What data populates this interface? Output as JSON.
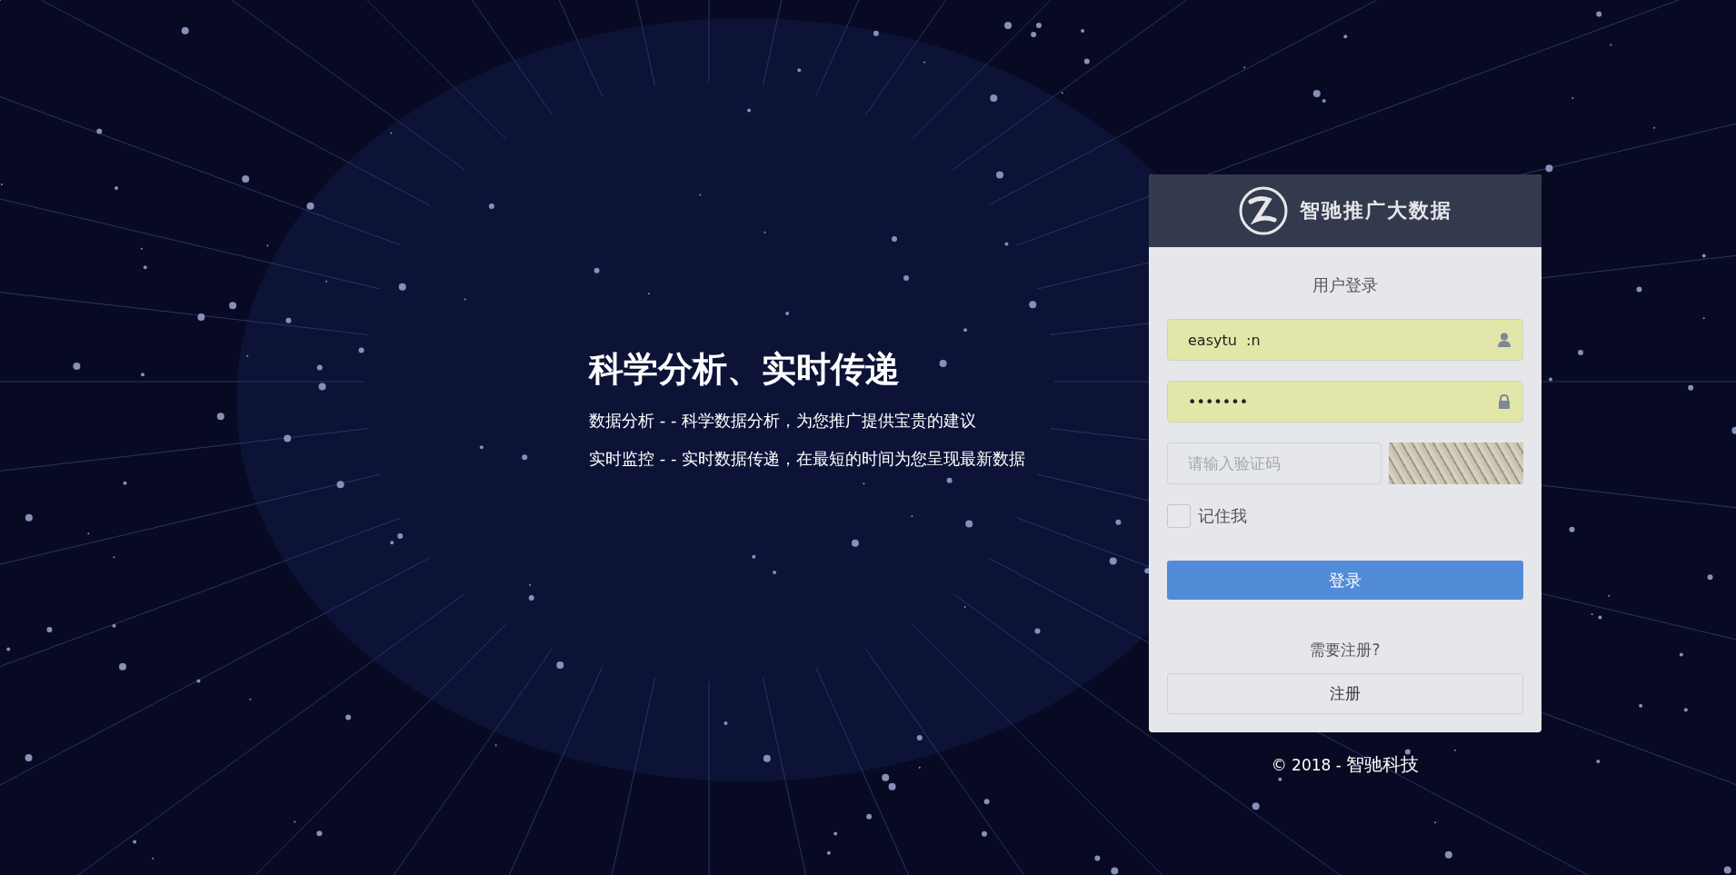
{
  "hero": {
    "heading": "科学分析、实时传递",
    "lines": [
      "数据分析 - - 科学数据分析，为您推广提供宝贵的建议",
      "实时监控 - - 实时数据传递，在最短的时间为您呈现最新数据"
    ]
  },
  "login": {
    "brand": "智驰推广大数据",
    "title": "用户登录",
    "username": {
      "value": "easytu  :n"
    },
    "password": {
      "value": "•••••••"
    },
    "captcha": {
      "placeholder": "请输入验证码"
    },
    "remember": {
      "label": "记住我",
      "checked": false
    },
    "submit": "登录",
    "register_prompt": "需要注册?",
    "register": "注册"
  },
  "footer": {
    "copyright": "© 2018 - ",
    "company": "智驰科技"
  }
}
